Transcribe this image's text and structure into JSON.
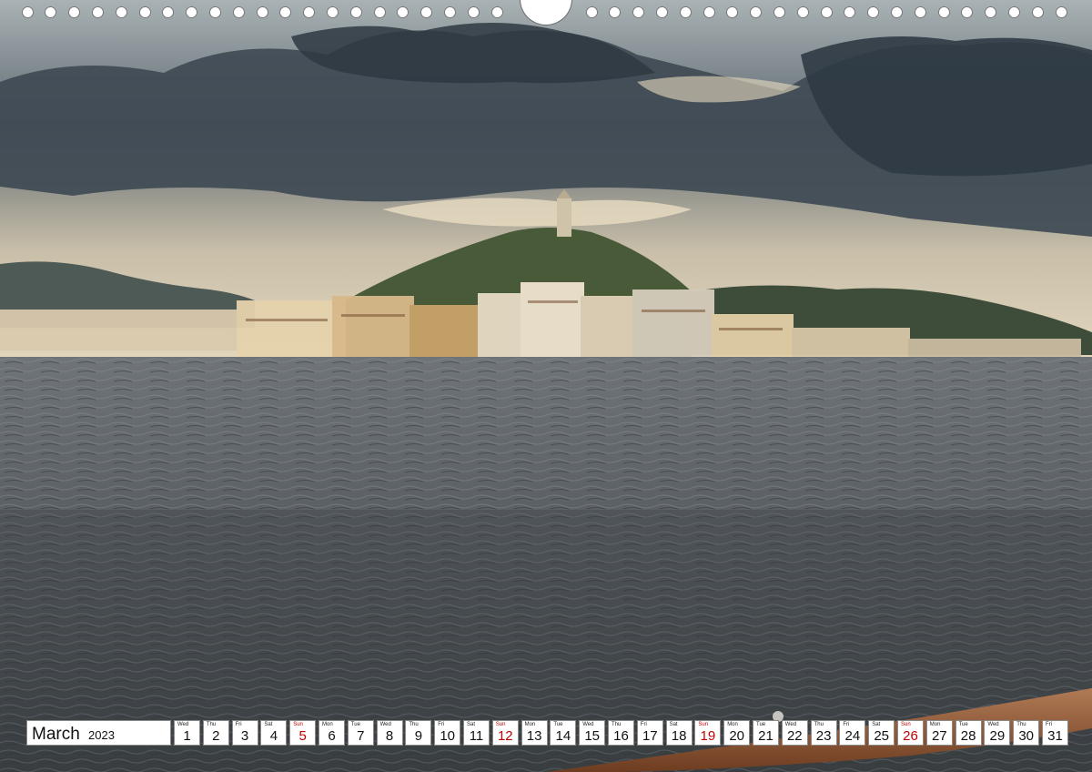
{
  "calendar": {
    "month": "March",
    "year": "2023",
    "sunday_color": "#c10000",
    "days": [
      {
        "wd": "Wed",
        "d": "1",
        "sun": false
      },
      {
        "wd": "Thu",
        "d": "2",
        "sun": false
      },
      {
        "wd": "Fri",
        "d": "3",
        "sun": false
      },
      {
        "wd": "Sat",
        "d": "4",
        "sun": false
      },
      {
        "wd": "Sun",
        "d": "5",
        "sun": true
      },
      {
        "wd": "Mon",
        "d": "6",
        "sun": false
      },
      {
        "wd": "Tue",
        "d": "7",
        "sun": false
      },
      {
        "wd": "Wed",
        "d": "8",
        "sun": false
      },
      {
        "wd": "Thu",
        "d": "9",
        "sun": false
      },
      {
        "wd": "Fri",
        "d": "10",
        "sun": false
      },
      {
        "wd": "Sat",
        "d": "11",
        "sun": false
      },
      {
        "wd": "Sun",
        "d": "12",
        "sun": true
      },
      {
        "wd": "Mon",
        "d": "13",
        "sun": false
      },
      {
        "wd": "Tue",
        "d": "14",
        "sun": false
      },
      {
        "wd": "Wed",
        "d": "15",
        "sun": false
      },
      {
        "wd": "Thu",
        "d": "16",
        "sun": false
      },
      {
        "wd": "Fri",
        "d": "17",
        "sun": false
      },
      {
        "wd": "Sat",
        "d": "18",
        "sun": false
      },
      {
        "wd": "Sun",
        "d": "19",
        "sun": true
      },
      {
        "wd": "Mon",
        "d": "20",
        "sun": false
      },
      {
        "wd": "Tue",
        "d": "21",
        "sun": false
      },
      {
        "wd": "Wed",
        "d": "22",
        "sun": false
      },
      {
        "wd": "Thu",
        "d": "23",
        "sun": false
      },
      {
        "wd": "Fri",
        "d": "24",
        "sun": false
      },
      {
        "wd": "Sat",
        "d": "25",
        "sun": false
      },
      {
        "wd": "Sun",
        "d": "26",
        "sun": true
      },
      {
        "wd": "Mon",
        "d": "27",
        "sun": false
      },
      {
        "wd": "Tue",
        "d": "28",
        "sun": false
      },
      {
        "wd": "Wed",
        "d": "29",
        "sun": false
      },
      {
        "wd": "Thu",
        "d": "30",
        "sun": false
      },
      {
        "wd": "Fri",
        "d": "31",
        "sun": false
      }
    ]
  }
}
